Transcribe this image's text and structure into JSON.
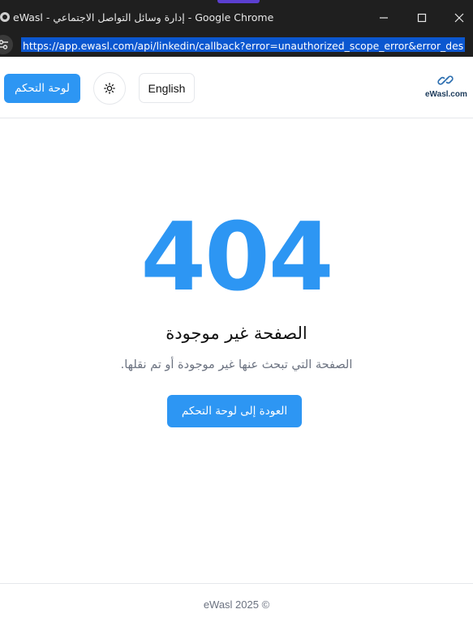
{
  "browser": {
    "window_title": "eWasl - إدارة وسائل التواصل الاجتماعي - Google Chrome",
    "url": "https://app.ewasl.com/api/linkedin/callback?error=unauthorized_scope_error&error_des",
    "controls": {
      "minimize_icon": "minimize-icon",
      "maximize_icon": "maximize-icon",
      "close_icon": "close-icon"
    }
  },
  "header": {
    "dashboard_button": "لوحة التحكم",
    "theme_toggle_icon": "sun-icon",
    "language_button": "English",
    "logo_text": "eWasl.com",
    "logo_icon": "link-icon"
  },
  "error": {
    "code": "404",
    "title": "الصفحة غير موجودة",
    "description": "الصفحة التي تبحث عنها غير موجودة أو تم نقلها.",
    "back_button": "العودة إلى لوحة التحكم"
  },
  "footer": {
    "copyright": "eWasl 2025 ©"
  },
  "colors": {
    "primary": "#2d96f3",
    "browser_chrome": "#1f1f1f",
    "url_highlight": "#0b57d0"
  }
}
